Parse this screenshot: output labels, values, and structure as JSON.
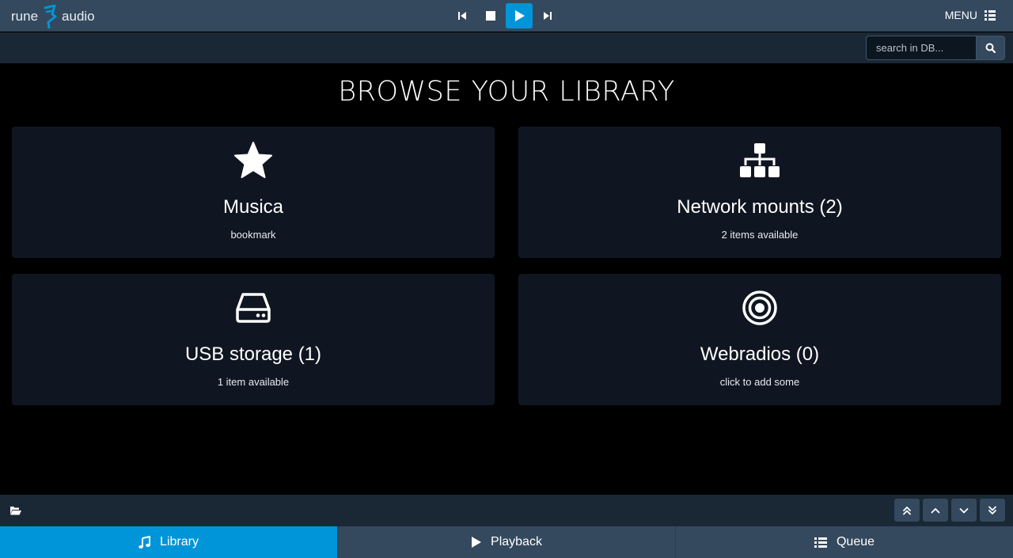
{
  "logo": {
    "left": "rune",
    "right": "audio"
  },
  "transport": {
    "prev_icon": "skip-previous-icon",
    "stop_icon": "stop-icon",
    "play_icon": "play-icon",
    "next_icon": "skip-next-icon"
  },
  "menu": {
    "label": "MENU",
    "icon": "list-grid-icon"
  },
  "search": {
    "placeholder": "search in DB...",
    "icon": "search-icon"
  },
  "page_title": "BROWSE YOUR LIBRARY",
  "cards": [
    {
      "title": "Musica",
      "subtitle": "bookmark",
      "icon": "star-icon"
    },
    {
      "title": "Network mounts (2)",
      "subtitle": "2 items available",
      "icon": "sitemap-icon"
    },
    {
      "title": "USB storage (1)",
      "subtitle": "1 item available",
      "icon": "hdd-icon"
    },
    {
      "title": "Webradios (0)",
      "subtitle": "click to add some",
      "icon": "radio-target-icon"
    }
  ],
  "footer": {
    "folder_icon": "folder-open-icon",
    "scroll": [
      "double-chevron-up-icon",
      "chevron-up-icon",
      "chevron-down-icon",
      "double-chevron-down-icon"
    ]
  },
  "tabs": [
    {
      "label": "Library",
      "icon": "music-note-icon",
      "active": true
    },
    {
      "label": "Playback",
      "icon": "play-icon",
      "active": false
    },
    {
      "label": "Queue",
      "icon": "list-icon",
      "active": false
    }
  ],
  "colors": {
    "accent": "#0095d8",
    "bar": "#34495e",
    "strip": "#1a2836",
    "card": "#101621"
  }
}
